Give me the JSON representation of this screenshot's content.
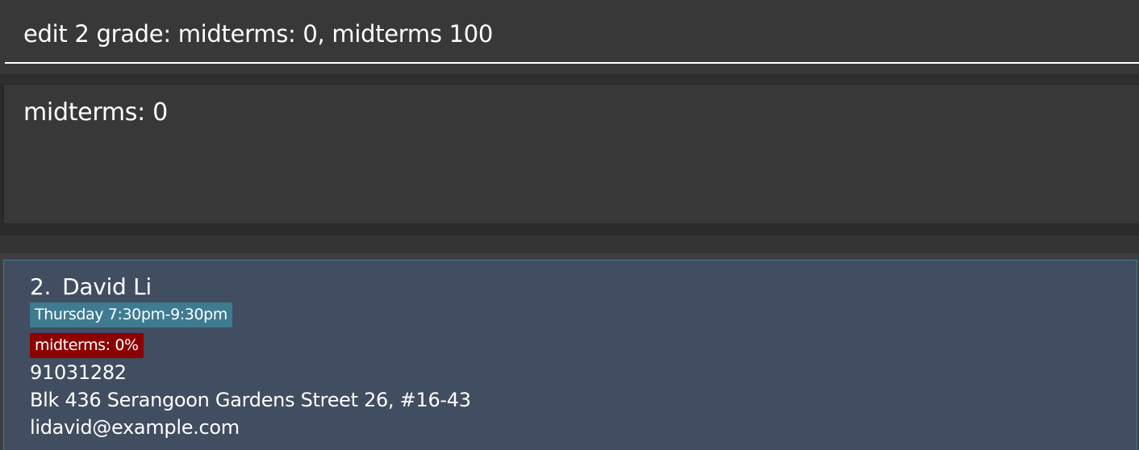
{
  "command_box": {
    "input_value": "edit 2 grade: midterms: 0, midterms 100"
  },
  "result_display": {
    "message": "midterms: 0"
  },
  "person_list": {
    "items": [
      {
        "index": "2.",
        "name": "David Li",
        "tags": {
          "schedule": "Thursday 7:30pm-9:30pm",
          "grade": "midterms: 0%"
        },
        "phone": "91031282",
        "address": "Blk 436 Serangoon Gardens Street 26, #16-43",
        "email": "lidavid@example.com"
      }
    ]
  },
  "colors": {
    "background": "#2b2b2b",
    "panel": "#383838",
    "card": "#414d60",
    "schedule_tag": "#3e7b91",
    "grade_tag": "#8b0000",
    "text": "#ffffff"
  }
}
